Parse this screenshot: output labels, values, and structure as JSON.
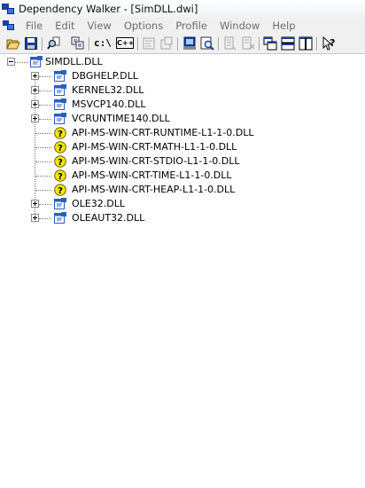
{
  "window": {
    "title": "Dependency Walker - [SimDLL.dwi]"
  },
  "menu": [
    "File",
    "Edit",
    "View",
    "Options",
    "Profile",
    "Window",
    "Help"
  ],
  "toolbar": {
    "buttons": [
      {
        "name": "open-icon"
      },
      {
        "name": "save-icon"
      },
      {
        "name": "find-icon"
      },
      {
        "name": "copy-module-icon"
      },
      {
        "name": "full-paths-icon"
      },
      {
        "name": "undecorate-icon"
      },
      {
        "name": "properties-disabled-icon"
      },
      {
        "name": "system-info-disabled-icon"
      },
      {
        "name": "external-viewer-icon"
      },
      {
        "name": "quick-view-icon"
      },
      {
        "name": "expand-disabled-icon"
      },
      {
        "name": "collapse-disabled-icon"
      },
      {
        "name": "cascade-icon"
      },
      {
        "name": "tile-horizontal-icon"
      },
      {
        "name": "tile-vertical-icon"
      },
      {
        "name": "context-help-icon"
      }
    ],
    "path_label": "c:\\",
    "cpp_label": "C++"
  },
  "tree": {
    "root": "SIMDLL.DLL",
    "children": [
      {
        "label": "DBGHELP.DLL",
        "status": "ok",
        "expandable": true
      },
      {
        "label": "KERNEL32.DLL",
        "status": "ok",
        "expandable": true
      },
      {
        "label": "MSVCP140.DLL",
        "status": "ok",
        "expandable": true
      },
      {
        "label": "VCRUNTIME140.DLL",
        "status": "ok",
        "expandable": true
      },
      {
        "label": "API-MS-WIN-CRT-RUNTIME-L1-1-0.DLL",
        "status": "missing",
        "expandable": false
      },
      {
        "label": "API-MS-WIN-CRT-MATH-L1-1-0.DLL",
        "status": "missing",
        "expandable": false
      },
      {
        "label": "API-MS-WIN-CRT-STDIO-L1-1-0.DLL",
        "status": "missing",
        "expandable": false
      },
      {
        "label": "API-MS-WIN-CRT-TIME-L1-1-0.DLL",
        "status": "missing",
        "expandable": false
      },
      {
        "label": "API-MS-WIN-CRT-HEAP-L1-1-0.DLL",
        "status": "missing",
        "expandable": false
      },
      {
        "label": "OLE32.DLL",
        "status": "ok",
        "expandable": true
      },
      {
        "label": "OLEAUT32.DLL",
        "status": "ok",
        "expandable": true
      }
    ]
  },
  "colors": {
    "missing": "#f5e400",
    "module": "#2b5fc0",
    "menu_text": "#6d6d6d"
  }
}
